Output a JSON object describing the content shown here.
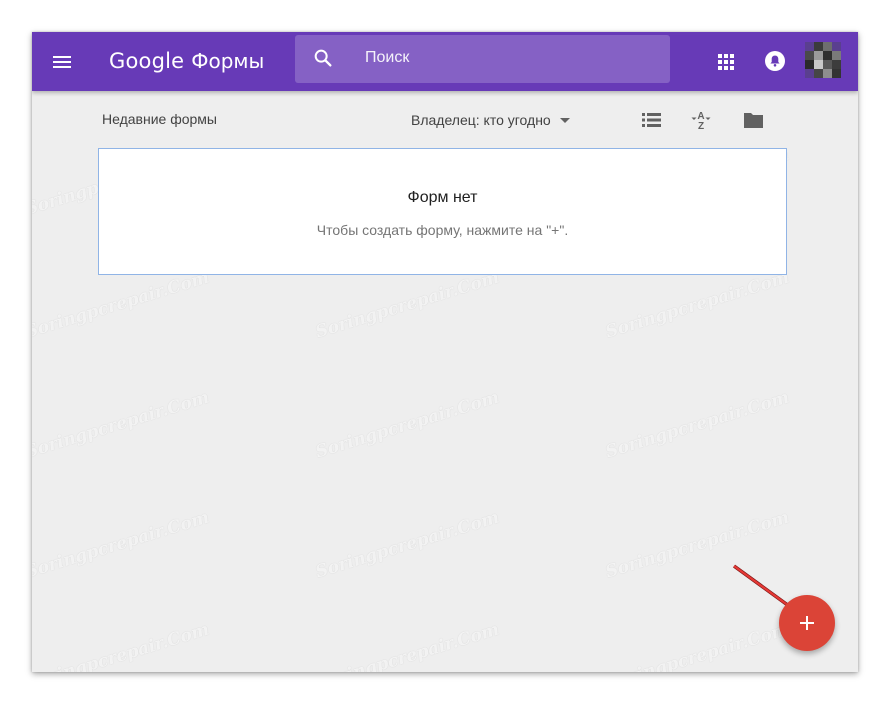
{
  "appbar": {
    "brand_google": "Google",
    "brand_product": "Формы",
    "search_placeholder": "Поиск",
    "menu_icon": "hamburger-menu-icon",
    "apps_icon": "apps-grid-icon",
    "notifications_icon": "notifications-bell-icon",
    "color": "#673ab7"
  },
  "toolbar": {
    "recent_label": "Недавние формы",
    "owner_filter_label": "Владелец: кто угодно",
    "list_view_icon": "list-view-icon",
    "sort_icon": "sort-az-icon",
    "folder_icon": "folder-icon"
  },
  "empty_state": {
    "title": "Форм нет",
    "subtitle": "Чтобы создать форму, нажмите на \"+\"."
  },
  "fab": {
    "label": "+",
    "icon": "plus-icon",
    "color": "#db4437"
  },
  "watermark": {
    "text": "Soringpcrepair.Com"
  }
}
